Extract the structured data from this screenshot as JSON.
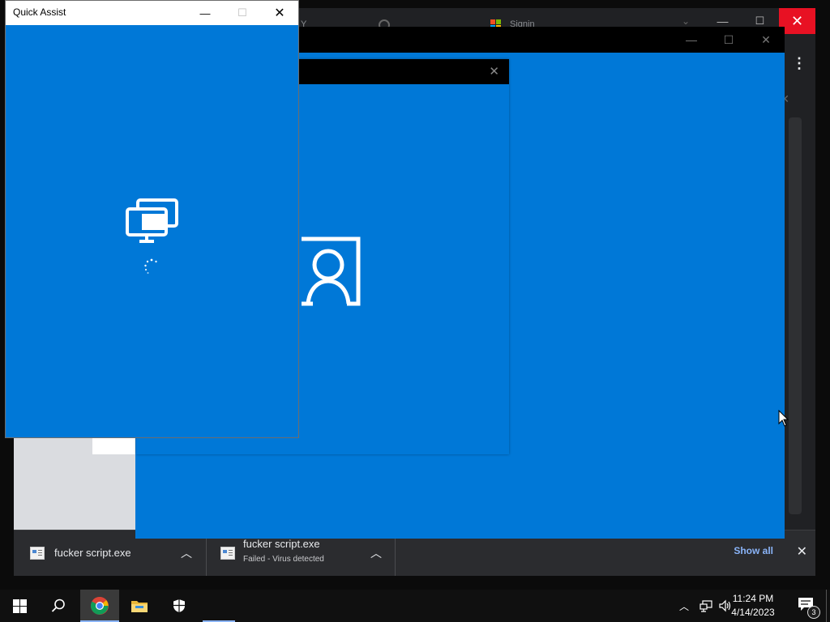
{
  "chrome": {
    "tabs": [
      {
        "label": "Y"
      },
      {
        "label": "Signin"
      }
    ],
    "window_controls": {
      "minimize": "—",
      "maximize": "☐",
      "close": "✕"
    },
    "menu_glyph": "⋮",
    "panel_close": "✕"
  },
  "downloads": {
    "items": [
      {
        "filename": "fucker script.exe",
        "status": ""
      },
      {
        "filename": "fucker script.exe",
        "status": "Failed - Virus detected"
      }
    ],
    "show_all_label": "Show all",
    "close_glyph": "✕"
  },
  "blue_window": {
    "controls": {
      "minimize": "—",
      "maximize": "☐",
      "close": "✕"
    },
    "color": "#0078d7"
  },
  "mid_dialog": {
    "close_glyph": "✕",
    "icon": "user-account-icon"
  },
  "quick_assist": {
    "title": "Quick Assist",
    "controls": {
      "minimize": "—",
      "maximize": "☐",
      "close": "✕"
    },
    "icon": "remote-desktop-icon",
    "loading_icon": "spinner-icon"
  },
  "taskbar": {
    "apps": [
      "start-icon",
      "search-icon",
      "chrome-icon",
      "file-explorer-icon",
      "windows-security-icon"
    ],
    "tray": {
      "time": "11:24 PM",
      "date": "4/14/2023",
      "notification_count": "3"
    }
  },
  "colors": {
    "accent_blue": "#0078d7",
    "chrome_close_red": "#e81123",
    "link_blue": "#8ab4f8"
  }
}
